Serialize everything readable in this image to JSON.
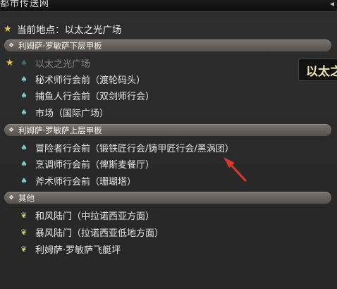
{
  "window": {
    "title": "都市传送网",
    "close_glyph": "◂"
  },
  "current_location": {
    "text": "当前地点：以太之光广场"
  },
  "sections": [
    {
      "header": "利姆萨·罗敏萨下层甲板",
      "items": [
        {
          "label": "以太之光广场",
          "favorite": true,
          "current": true
        },
        {
          "label": "秘术师行会前（渡轮码头）"
        },
        {
          "label": "捕鱼人行会前（双剑师行会）"
        },
        {
          "label": "市场（国际广场）"
        }
      ]
    },
    {
      "header": "利姆萨·罗敏萨上层甲板",
      "items": [
        {
          "label": "冒险者行会前（锻铁匠行会/铸甲匠行会/黑涡团）"
        },
        {
          "label": "烹调师行会前（俾斯麦餐厅）"
        },
        {
          "label": "斧术师行会前（珊瑚塔）"
        }
      ]
    },
    {
      "header": "其他",
      "items": [
        {
          "label": "和风陆门（中拉诺西亚方面）"
        },
        {
          "label": "暴风陆门（拉诺西亚低地方面）"
        },
        {
          "label": "利姆萨·罗敏萨飞艇坪"
        }
      ]
    }
  ],
  "tooltip": {
    "text": "以太之光广场"
  },
  "annotation": {
    "arrow_color": "#e0352b"
  },
  "colors": {
    "star": "#e9c54c",
    "aetheryte_icon": "#6fd1c9",
    "gate_icon": "#c8cf6a",
    "section_header": "#6b6560"
  },
  "icons": {
    "star": "star-icon",
    "section": "diamond-cluster-icon",
    "aetheryte": "aetheryte-crystal-icon",
    "gate": "gate-leaf-icon"
  }
}
